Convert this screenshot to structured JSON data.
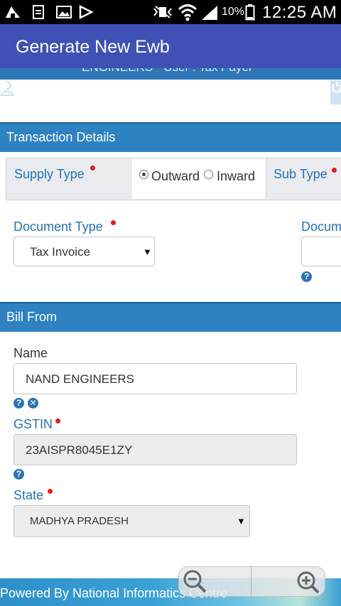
{
  "status_bar": {
    "battery_percent": "10%",
    "time": "12:25 AM"
  },
  "app_bar": {
    "title": "Generate New Ewb"
  },
  "web_header": {
    "user_text": "ENGINEERS - User : Tax Payer"
  },
  "transaction_section": {
    "title": "Transaction Details",
    "supply_type_label": "Supply Type",
    "supply_options": [
      "Outward",
      "Inward"
    ],
    "supply_selected": "Outward",
    "sub_type_label": "Sub Type",
    "document_type_label": "Document Type",
    "document_type_value": "Tax Invoice",
    "document_no_label": "Docum"
  },
  "bill_from_section": {
    "title": "Bill From",
    "name_label": "Name",
    "name_value": "NAND ENGINEERS",
    "gstin_label": "GSTIN",
    "gstin_value": "23AISPR8045E1ZY",
    "state_label": "State",
    "state_value": "MADHYA PRADESH"
  },
  "footer": {
    "text": "Powered By National Informatics Centre"
  },
  "colors": {
    "app_bar": "#3f51b5",
    "section_header": "#2e82c2",
    "label_blue": "#2672b6",
    "required_star": "#e41b1b"
  }
}
